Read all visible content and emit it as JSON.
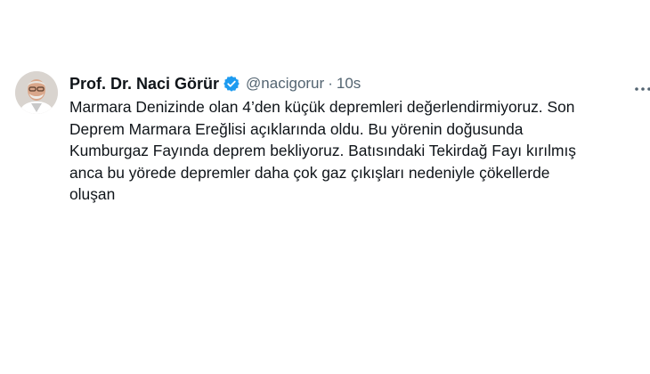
{
  "author": {
    "display_name": "Prof. Dr. Naci Görür",
    "handle": "@nacigorur",
    "separator": "·",
    "time": "10s",
    "verified_color": "#1d9bf0"
  },
  "tweet": {
    "text": "Marmara Denizinde olan 4’den küçük depremleri değerlendirmiyoruz. Son\nDeprem Marmara Ereğlisi açıklarında oldu. Bu yörenin doğusunda\nKumburgaz Fayında deprem bekliyoruz. Batısındaki Tekirdağ Fayı kırılmış\nanca bu yörede depremler daha çok gaz çıkışları nedeniyle çökellerde\noluşan"
  },
  "icons": {
    "avatar": "profile-photo",
    "verified": "verified-badge-icon",
    "more": "more-options-icon"
  }
}
